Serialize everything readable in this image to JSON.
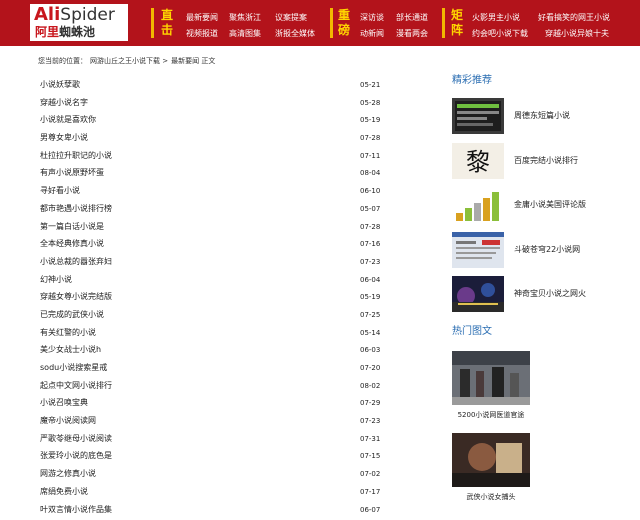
{
  "logo": {
    "en_a": "Ali",
    "en_b": "Spider",
    "cn_a": "阿里",
    "cn_b": "蜘蛛池"
  },
  "nav": [
    {
      "head": "直击",
      "links": [
        "最新要闻",
        "聚焦浙江",
        "议案提案",
        "视频报道",
        "高清图集",
        "浙报全媒体"
      ]
    },
    {
      "head": "重磅",
      "links": [
        "深访谈",
        "部长通道",
        "动新闻",
        "漫看两会"
      ]
    },
    {
      "head": "矩阵",
      "links": [
        "火影男主小说",
        "好看搞笑的网王小说",
        "约会吧小说下载",
        "穿越小说异娘十夫"
      ]
    }
  ],
  "breadcrumb": {
    "prefix": "您当前的位置：",
    "home": "网游山丘之王小说下载",
    "sep": ">",
    "section": "最新要闻",
    "current": "正文"
  },
  "articles": [
    {
      "title": "小说妖孽歌",
      "date": "05-21"
    },
    {
      "title": "穿越小说名字",
      "date": "05-28"
    },
    {
      "title": "小说就是喜欢你",
      "date": "05-19"
    },
    {
      "title": "男尊女卑小说",
      "date": "07-28"
    },
    {
      "title": "杜拉拉升职记的小说",
      "date": "07-11"
    },
    {
      "title": "有声小说原野坏蛋",
      "date": "08-04"
    },
    {
      "title": "寻好看小说",
      "date": "06-10"
    },
    {
      "title": "都市艳遇小说排行榜",
      "date": "05-07"
    },
    {
      "title": "第一篇白话小说是",
      "date": "07-28"
    },
    {
      "title": "全本经典修真小说",
      "date": "07-16"
    },
    {
      "title": "小说总裁的囂张弃妇",
      "date": "07-23"
    },
    {
      "title": "幻神小说",
      "date": "06-04"
    },
    {
      "title": "穿越女尊小说完结版",
      "date": "05-19"
    },
    {
      "title": "已完成的武侠小说",
      "date": "07-25"
    },
    {
      "title": "有关红警的小说",
      "date": "05-14"
    },
    {
      "title": "美少女战士小说h",
      "date": "06-03"
    },
    {
      "title": "sodu小说搜索星戒",
      "date": "07-20"
    },
    {
      "title": "起点中文网小说排行",
      "date": "08-02"
    },
    {
      "title": "小说召唤宝典",
      "date": "07-29"
    },
    {
      "title": "魔帝小说阅读网",
      "date": "07-23"
    },
    {
      "title": "严歌苓继母小说阅读",
      "date": "07-31"
    },
    {
      "title": "张爱玲小说的底色是",
      "date": "07-15"
    },
    {
      "title": "网游之修真小说",
      "date": "07-02"
    },
    {
      "title": "席绢免费小说",
      "date": "07-17"
    },
    {
      "title": "叶双言情小说作品集",
      "date": "06-07"
    }
  ],
  "sidebar": {
    "rec_title": "精彩推荐",
    "recommended": [
      {
        "label": "周德东短篇小说",
        "thumb_icon": "phone-screenshot-thumb"
      },
      {
        "label": "百度完结小说排行",
        "thumb_icon": "calligraphy-thumb",
        "glyph": "黎"
      },
      {
        "label": "金庸小说美国评论版",
        "thumb_icon": "chart-bars-thumb"
      },
      {
        "label": "斗破苍穹22小说网",
        "thumb_icon": "screenshot-thumb"
      },
      {
        "label": "神奇宝贝小说之网火",
        "thumb_icon": "night-city-thumb"
      }
    ],
    "hot_title": "热门图文",
    "hot": [
      {
        "caption": "5200小说网医道官途",
        "thumb_icon": "station-photo-thumb"
      },
      {
        "caption": "武侠小说女捕头",
        "thumb_icon": "action-photo-thumb"
      }
    ]
  },
  "colors": {
    "header_red": "#b3131b",
    "nav_head_yellow": "#ffd400",
    "side_title_blue": "#2a6db2"
  }
}
